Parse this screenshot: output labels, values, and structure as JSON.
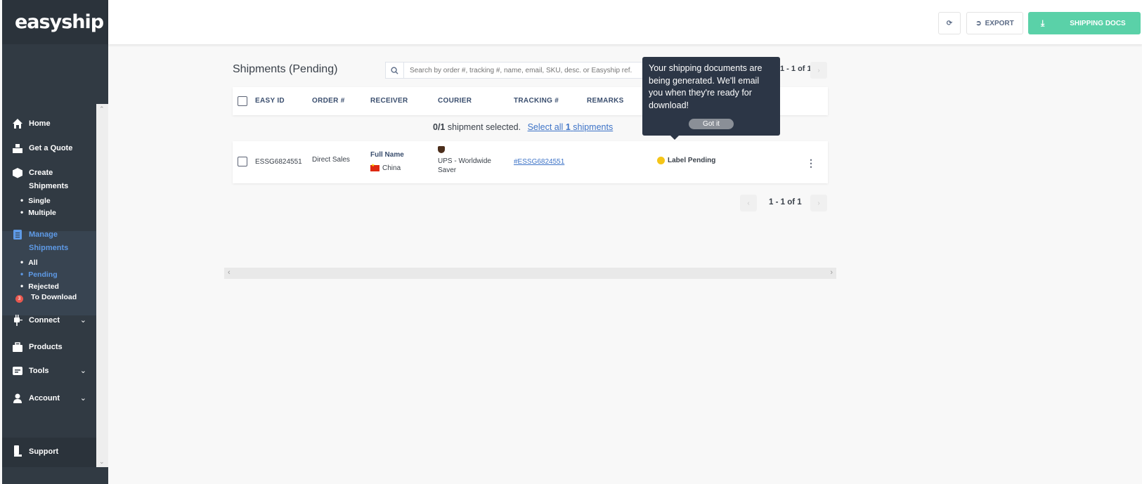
{
  "brand": {
    "logo_text": "easyship",
    "accent_color": "#3ec999",
    "link_color": "#3d73c7"
  },
  "header": {
    "export_label": "EXPORT",
    "shipping_docs_label": "SHIPPING DOCS"
  },
  "sidebar": {
    "home": "Home",
    "quote": "Get a Quote",
    "create": "Create",
    "create_sub": "Shipments",
    "single": "Single",
    "multiple": "Multiple",
    "manage": "Manage",
    "manage_sub": "Shipments",
    "all": "All",
    "pending": "Pending",
    "rejected": "Rejected",
    "to_download": "To Download",
    "to_download_count": "3",
    "connect": "Connect",
    "products": "Products",
    "tools": "Tools",
    "account": "Account",
    "support": "Support"
  },
  "main": {
    "title": "Shipments (Pending)",
    "search_placeholder": "Search by order #, tracking #, name, email, SKU, desc. or Easyship ref.",
    "pager_top": "1 - 1 of 1",
    "pager_bottom": "1 - 1 of 1",
    "columns": [
      "EASY ID",
      "ORDER #",
      "RECEIVER",
      "COURIER",
      "TRACKING #",
      "REMARKS"
    ],
    "selection_count": "0/1",
    "selection_text": "shipment selected.",
    "select_all": "Select all",
    "select_all_count": "1",
    "select_all_suffix": "shipments"
  },
  "shipments": [
    {
      "easy_id": "ESSG6824551",
      "order": "Direct Sales",
      "receiver_name": "Full Name",
      "receiver_country": "China",
      "courier_line1": "UPS - Worldwide",
      "courier_line2": "Saver",
      "tracking": "#ESSG6824551",
      "status": "Label Pending"
    }
  ],
  "tooltip": {
    "text": "Your shipping documents are being generated. We'll email you when they're ready for download!",
    "button": "Got it"
  }
}
